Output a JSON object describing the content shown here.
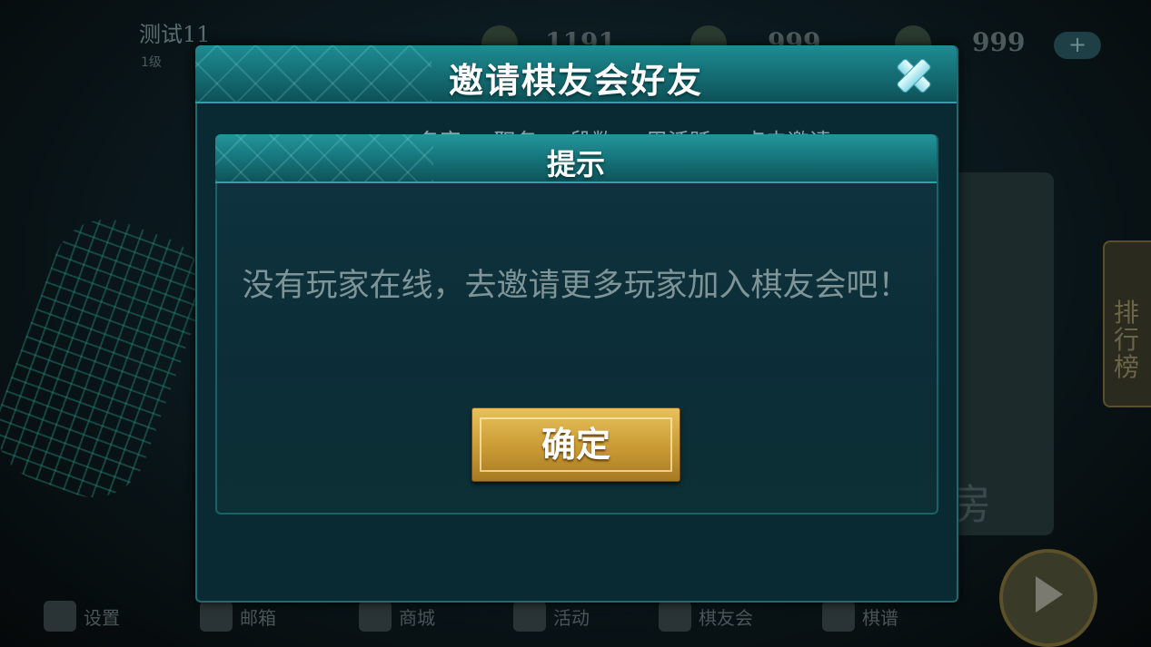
{
  "player": {
    "name": "测试11",
    "level": "1级"
  },
  "resources": {
    "coins": "1191",
    "gems": "999",
    "tickets": "999",
    "plus_label": "+"
  },
  "side": {
    "rank_label": "排行榜",
    "card_text": "房"
  },
  "bottom_nav": [
    {
      "label": "设置",
      "icon": "gear-icon"
    },
    {
      "label": "邮箱",
      "icon": "mail-icon"
    },
    {
      "label": "商城",
      "icon": "cart-icon"
    },
    {
      "label": "活动",
      "icon": "gift-icon"
    },
    {
      "label": "棋友会",
      "icon": "club-icon"
    },
    {
      "label": "棋谱",
      "icon": "book-icon"
    }
  ],
  "invite_dialog": {
    "title": "邀请棋友会好友",
    "columns": [
      "名字",
      "职务",
      "段数",
      "周活跃",
      "点击邀请"
    ]
  },
  "tip_dialog": {
    "title": "提示",
    "message": "没有玩家在线，去邀请更多玩家加入棋友会吧！",
    "ok_label": "确定"
  },
  "colors": {
    "accent_teal": "#1f8c93",
    "button_gold": "#c99a34"
  }
}
